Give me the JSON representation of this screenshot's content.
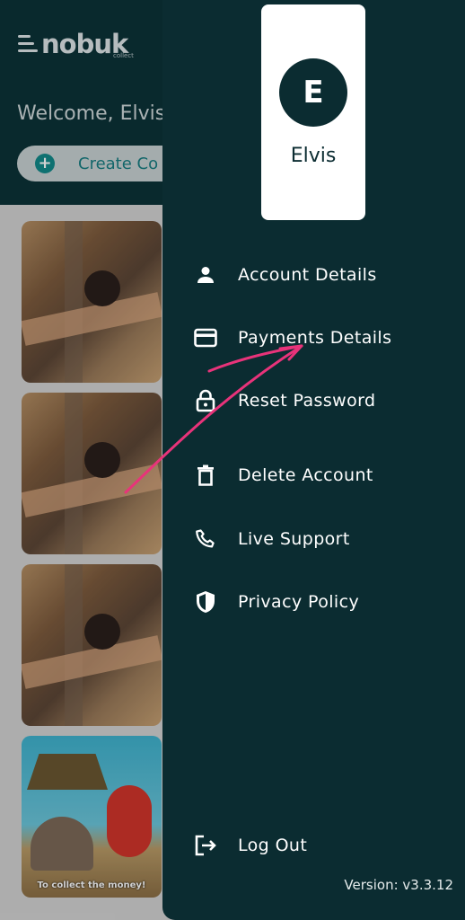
{
  "background": {
    "brand": "nobuk",
    "brand_sub": "collect",
    "welcome": "Welcome, Elvis",
    "create_button_label": "Create Co",
    "cards": [
      {
        "kind": "photo",
        "caption": ""
      },
      {
        "kind": "photo",
        "caption": ""
      },
      {
        "kind": "photo",
        "caption": ""
      },
      {
        "kind": "cartoon",
        "caption": "To collect the money!"
      }
    ]
  },
  "drawer": {
    "profile": {
      "initial": "E",
      "name": "Elvis"
    },
    "menu": [
      {
        "label": "Account Details",
        "icon": "person-icon"
      },
      {
        "label": "Payments Details",
        "icon": "credit-card-icon"
      },
      {
        "label": "Reset Password",
        "icon": "lock-icon"
      },
      {
        "label": "Delete Account",
        "icon": "trash-icon"
      },
      {
        "label": "Live Support",
        "icon": "phone-icon"
      },
      {
        "label": "Privacy Policy",
        "icon": "shield-icon"
      }
    ],
    "logout_label": "Log Out",
    "version": "Version: v3.3.12"
  },
  "colors": {
    "drawer_bg": "#0b2c31",
    "accent": "#128a8a",
    "annotation": "#e8337a"
  }
}
